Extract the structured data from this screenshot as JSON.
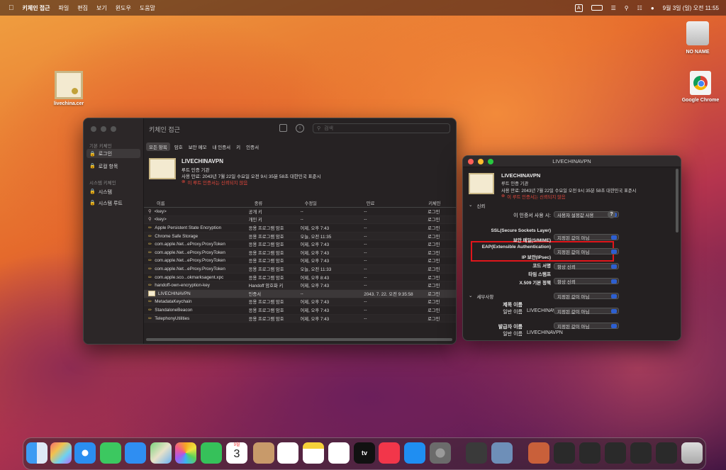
{
  "menubar": {
    "app": "키체인 접근",
    "items": [
      "파일",
      "편집",
      "보기",
      "윈도우",
      "도움말"
    ],
    "input_indicator": "A",
    "clock": "9월 3일 (일) 오전 11:55"
  },
  "desktop": {
    "cert_file": "livechina.cer",
    "drive": "NO NAME",
    "chrome": "Google Chrome"
  },
  "keychain": {
    "title": "키체인 접근",
    "search_placeholder": "검색",
    "sidebar_default_header": "기본 키체인",
    "sidebar_login": "로그인",
    "sidebar_local": "로컬 항목",
    "sidebar_system_header": "시스템 키체인",
    "sidebar_system": "시스템",
    "sidebar_system_roots": "시스템 루트",
    "tabs": [
      "모든 항목",
      "암호",
      "보안 메모",
      "내 인증서",
      "키",
      "인증서"
    ],
    "cert": {
      "name": "LIVECHINAVPN",
      "type": "루트 인증 기관",
      "expiry": "사용 만료: 2043년 7월 22일 수요일 오전 9시 35분 58초 대한민국 표준시",
      "warning": "이 루트 인증서는 신뢰되지 않음"
    },
    "columns": [
      "이름",
      "종류",
      "수정일",
      "만료",
      "키체인"
    ],
    "rows": [
      {
        "name": "<key>",
        "kind": "공개 키",
        "modified": "--",
        "expires": "--",
        "keychain": "로그인"
      },
      {
        "name": "<key>",
        "kind": "개인 키",
        "modified": "--",
        "expires": "--",
        "keychain": "로그인"
      },
      {
        "name": "Apple Persistent State Encryption",
        "kind": "응용 프로그램 암호",
        "modified": "어제, 오후 7:43",
        "expires": "--",
        "keychain": "로그인"
      },
      {
        "name": "Chrome Safe Storage",
        "kind": "응용 프로그램 암호",
        "modified": "오늘, 오전 11:35",
        "expires": "--",
        "keychain": "로그인"
      },
      {
        "name": "com.apple.Net...eProxy.ProxyToken",
        "kind": "응용 프로그램 암호",
        "modified": "어제, 오후 7:43",
        "expires": "--",
        "keychain": "로그인"
      },
      {
        "name": "com.apple.Net...eProxy.ProxyToken",
        "kind": "응용 프로그램 암호",
        "modified": "어제, 오후 7:43",
        "expires": "--",
        "keychain": "로그인"
      },
      {
        "name": "com.apple.Net...eProxy.ProxyToken",
        "kind": "응용 프로그램 암호",
        "modified": "어제, 오후 7:43",
        "expires": "--",
        "keychain": "로그인"
      },
      {
        "name": "com.apple.Net...eProxy.ProxyToken",
        "kind": "응용 프로그램 암호",
        "modified": "오늘, 오전 11:33",
        "expires": "--",
        "keychain": "로그인"
      },
      {
        "name": "com.apple.sco...okmarksagent.xpc",
        "kind": "응용 프로그램 암호",
        "modified": "어제, 오후 8:43",
        "expires": "--",
        "keychain": "로그인"
      },
      {
        "name": "handoff-own-encryption-key",
        "kind": "Handoff 암호화 키",
        "modified": "어제, 오후 7:43",
        "expires": "--",
        "keychain": "로그인"
      },
      {
        "name": "LIVECHINAVPN",
        "kind": "인증서",
        "modified": "--",
        "expires": "2043. 7. 22. 오전 9:35:58",
        "keychain": "로그인"
      },
      {
        "name": "MetadataKeychain",
        "kind": "응용 프로그램 암호",
        "modified": "어제, 오후 7:43",
        "expires": "--",
        "keychain": "로그인"
      },
      {
        "name": "StandaloneBeacon",
        "kind": "응용 프로그램 암호",
        "modified": "어제, 오후 7:43",
        "expires": "--",
        "keychain": "로그인"
      },
      {
        "name": "TelephonyUtilities",
        "kind": "응용 프로그램 암호",
        "modified": "어제, 오후 7:43",
        "expires": "--",
        "keychain": "로그인"
      }
    ]
  },
  "detail": {
    "title": "LIVECHINAVPN",
    "name": "LIVECHINAVPN",
    "type": "루트 인증 기관",
    "expiry": "사용 만료: 2043년 7월 22일 수요일 오전 9시 35분 58초 대한민국 표준시",
    "warning": "이 루트 인증서는 신뢰되지 않음",
    "trust_section": "신뢰",
    "when_using_label": "이 인증서 사용 시:",
    "when_using_value": "사용자 설정값 사용",
    "help": "?",
    "policies": [
      {
        "label": "SSL(Secure Sockets Layer)",
        "value": "지정된 값이 아님"
      },
      {
        "label": "보안 메일(S/MIME)",
        "value": "지정된 값이 아님"
      },
      {
        "label": "EAP(Extensible Authentication)",
        "value": "항상 신뢰"
      },
      {
        "label": "IP 보안(IPsec)",
        "value": "항상 신뢰"
      },
      {
        "label": "코드 서명",
        "value": "지정된 값이 아님"
      },
      {
        "label": "타임 스탬프",
        "value": "지정된 값이 아님"
      },
      {
        "label": "X.509 기본 정책",
        "value": "지정된 값이 아님"
      }
    ],
    "details_section": "세부사항",
    "subject_header": "제목 이름",
    "subject_cn_label": "일반 이름",
    "subject_cn_value": "LIVECHINAVPN",
    "issuer_header": "발급자 이름",
    "issuer_cn_label": "일반 이름",
    "issuer_cn_value": "LIVECHINAVPN"
  },
  "dock": {
    "calendar_month": "9월",
    "calendar_day": "3",
    "tv_label": "tv"
  },
  "colors": {
    "highlight_red": "#e0161b",
    "accent_blue": "#2d5fd1",
    "warning_red": "#e5483c"
  }
}
